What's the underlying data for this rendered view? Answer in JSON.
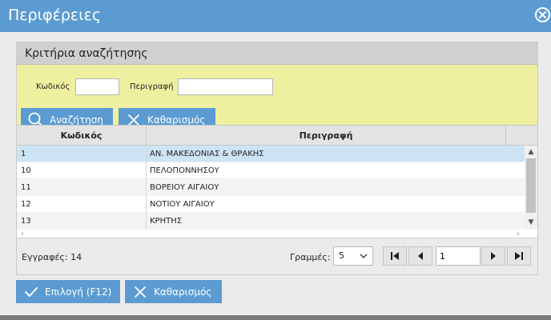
{
  "window": {
    "title": "Περιφέρειες"
  },
  "criteria": {
    "header": "Κριτήρια αναζήτησης",
    "code_label": "Κωδικός",
    "code_value": "",
    "desc_label": "Περιγραφή",
    "desc_value": "",
    "search_label": "Αναζήτηση",
    "clear_label": "Καθαρισμός"
  },
  "grid": {
    "columns": [
      "Κωδικός",
      "Περιγραφή"
    ],
    "rows": [
      {
        "code": "1",
        "desc": "ΑΝ. ΜΑΚΕΔΟΝΙΑΣ & ΘΡΑΚΗΣ",
        "selected": true
      },
      {
        "code": "10",
        "desc": "ΠΕΛΟΠΟΝΝΗΣΟΥ",
        "selected": false
      },
      {
        "code": "11",
        "desc": "ΒΟΡΕΙΟΥ ΑΙΓΑΙΟΥ",
        "selected": false
      },
      {
        "code": "12",
        "desc": "ΝΟΤΙΟΥ ΑΙΓΑΙΟΥ",
        "selected": false
      },
      {
        "code": "13",
        "desc": "ΚΡΗΤΗΣ",
        "selected": false
      }
    ]
  },
  "pager": {
    "records_text": "Εγγραφές: 14",
    "lines_label": "Γραμμές:",
    "page_size": "5",
    "current_page": "1"
  },
  "actions": {
    "select_label": "Επιλογή (F12)",
    "clear_label": "Καθαρισμός"
  },
  "colors": {
    "accent": "#5b9bd1",
    "criteria_bg": "#eef0a0",
    "selected_row": "#cde4f5"
  }
}
